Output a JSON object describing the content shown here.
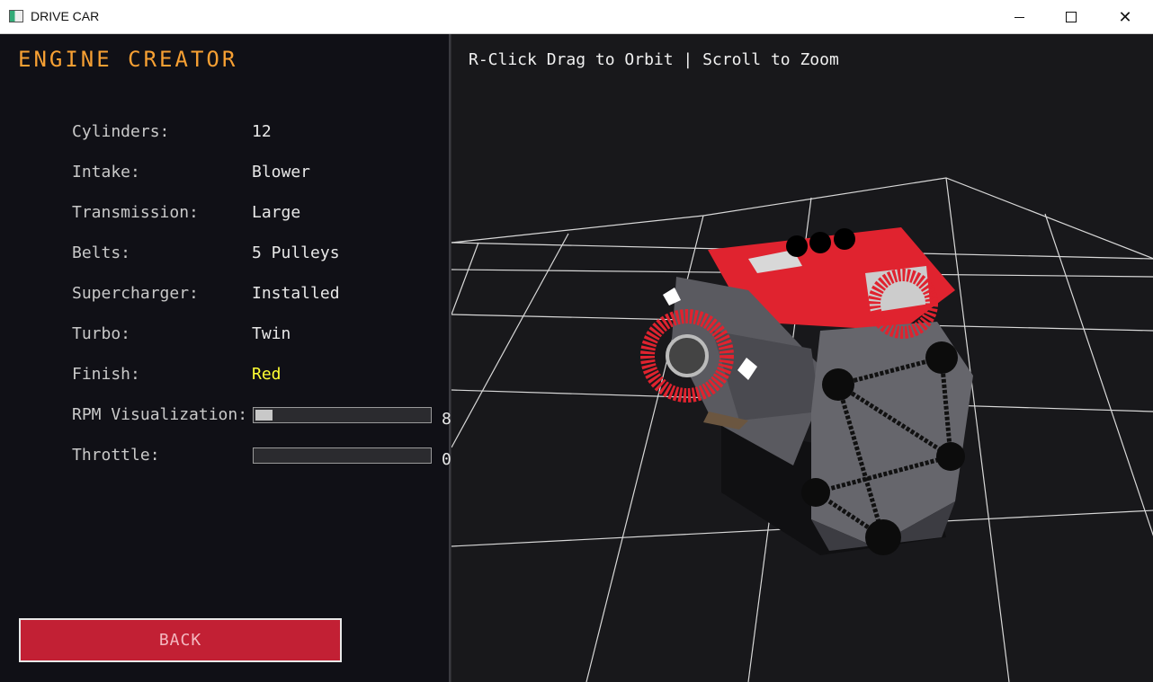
{
  "window": {
    "title": "DRIVE CAR",
    "close_glyph": "✕"
  },
  "panel": {
    "title": "ENGINE CREATOR",
    "rows": [
      {
        "label": "Cylinders:",
        "value": "12"
      },
      {
        "label": "Intake:",
        "value": "Blower"
      },
      {
        "label": "Transmission:",
        "value": "Large"
      },
      {
        "label": "Belts:",
        "value": "5 Pulleys"
      },
      {
        "label": "Supercharger:",
        "value": "Installed"
      },
      {
        "label": "Turbo:",
        "value": "Twin"
      },
      {
        "label": "Finish:",
        "value": "Red"
      }
    ],
    "finish_color": "#ffff33",
    "rpm": {
      "label": "RPM Visualization:",
      "value_text": "8",
      "fill_fraction": 0.1
    },
    "throttle": {
      "label": "Throttle:",
      "value_text": "0",
      "fill_fraction": 0.0
    },
    "back_label": "BACK"
  },
  "viewport": {
    "hint": "R-Click Drag to Orbit | Scroll to Zoom"
  },
  "colors": {
    "accent_title": "#f7a033",
    "back_button": "#c22034",
    "engine_red": "#e0232f"
  },
  "icons": {
    "app": "app-window-icon",
    "minimize": "minimize-icon",
    "maximize": "maximize-icon",
    "close": "close-icon"
  }
}
